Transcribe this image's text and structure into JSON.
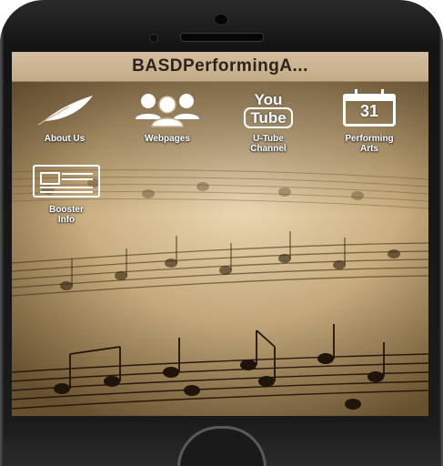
{
  "app": {
    "title": "BASDPerformingA..."
  },
  "icons": [
    {
      "id": "about",
      "label": "About Us",
      "icon": "feather-icon"
    },
    {
      "id": "webpages",
      "label": "Webpages",
      "icon": "people-icon"
    },
    {
      "id": "youtube",
      "label": "U-Tube\nChannel",
      "icon": "youtube-icon",
      "glyph_top": "You",
      "glyph_bottom": "Tube"
    },
    {
      "id": "performing",
      "label": "Performing\nArts",
      "icon": "calendar-icon",
      "glyph": "31"
    },
    {
      "id": "booster",
      "label": "Booster\nInfo",
      "icon": "newspaper-icon"
    }
  ],
  "colors": {
    "title_bar": "#c9b18c",
    "title_text": "#2b241c",
    "icon_white": "#ffffff",
    "phone_body": "#1a1a1a"
  }
}
